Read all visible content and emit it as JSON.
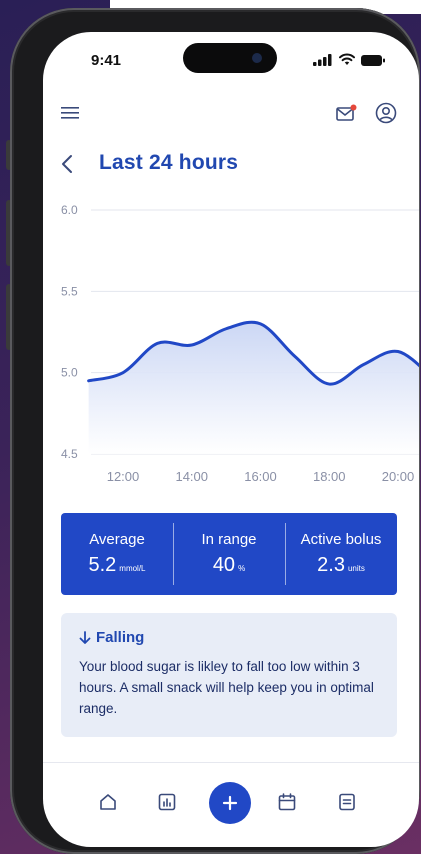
{
  "status_bar": {
    "time": "9:41"
  },
  "header": {
    "title": "Last 24 hours"
  },
  "chart_data": {
    "type": "area",
    "title": "",
    "xlabel": "",
    "ylabel": "",
    "ylim": [
      4.5,
      6.0
    ],
    "y_ticks": [
      "6.0",
      "5.5",
      "5.0",
      "4.5"
    ],
    "x_ticks": [
      "12:00",
      "14:00",
      "16:00",
      "18:00",
      "20:00"
    ],
    "grid": true,
    "series": [
      {
        "x": [
          "11:00",
          "12:00",
          "13:00",
          "14:00",
          "15:00",
          "16:00",
          "17:00",
          "18:00",
          "19:00",
          "20:00",
          "21:00"
        ],
        "values": [
          4.95,
          5.0,
          5.18,
          5.17,
          5.27,
          5.3,
          5.1,
          4.93,
          5.05,
          5.13,
          4.97
        ]
      }
    ],
    "colors": {
      "line": "#2148c6",
      "fill_top": "#c9d5f4",
      "fill_bottom": "#ffffff"
    }
  },
  "stats": [
    {
      "label": "Average",
      "value": "5.2",
      "unit": "mmol/L"
    },
    {
      "label": "In range",
      "value": "40",
      "unit": "%"
    },
    {
      "label": "Active bolus",
      "value": "2.3",
      "unit": "units"
    }
  ],
  "alert": {
    "title": "Falling",
    "text": "Your blood sugar is likley to fall too low within 3 hours. A small snack will help keep you in optimal range."
  },
  "nav": {
    "items": [
      "home-icon",
      "stats-icon",
      "add-icon",
      "calendar-icon",
      "notes-icon"
    ]
  },
  "colors": {
    "accent": "#2148c6",
    "title": "#2148b0",
    "alert_bg": "#e8edf7",
    "notification_dot": "#e5483b"
  }
}
